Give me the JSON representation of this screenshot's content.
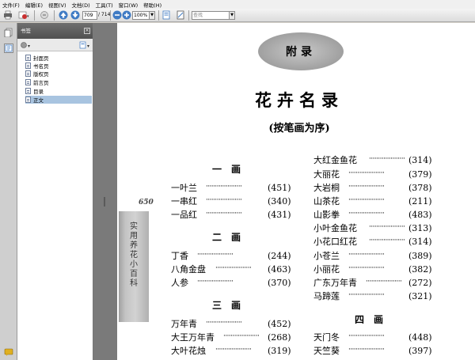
{
  "menu": [
    "文件(F)",
    "编辑(E)",
    "视图(V)",
    "文档(D)",
    "工具(T)",
    "窗口(W)",
    "帮助(H)"
  ],
  "toolbar": {
    "page_current": "709",
    "page_total": "/ 714",
    "zoom": "100%",
    "search_placeholder": "查找"
  },
  "panel": {
    "title": "书签",
    "close": "×",
    "bookmarks": [
      {
        "label": "封面页",
        "selected": false
      },
      {
        "label": "书名页",
        "selected": false
      },
      {
        "label": "版权页",
        "selected": false
      },
      {
        "label": "前言页",
        "selected": false
      },
      {
        "label": "目录",
        "selected": false
      },
      {
        "label": "正文",
        "selected": true
      }
    ]
  },
  "document": {
    "badge": "附录",
    "title": "花卉名录",
    "subtitle": "(按笔画为序)",
    "stamp_number": "650",
    "stamp_text": "实用养花小百科",
    "dots": "····················",
    "left_column": [
      {
        "heading": "一　画",
        "entries": [
          {
            "name": "一叶兰",
            "page": "(451)"
          },
          {
            "name": "一串红",
            "page": "(340)"
          },
          {
            "name": "一品红",
            "page": "(431)"
          }
        ]
      },
      {
        "heading": "二　画",
        "entries": [
          {
            "name": "丁香",
            "page": "(244)"
          },
          {
            "name": "八角金盘",
            "page": "(463)"
          },
          {
            "name": "人参",
            "page": "(370)"
          }
        ]
      },
      {
        "heading": "三　画",
        "entries": [
          {
            "name": "万年青",
            "page": "(452)"
          },
          {
            "name": "大王万年青",
            "page": "(268)"
          },
          {
            "name": "大叶花烛",
            "page": "(319)"
          }
        ]
      }
    ],
    "right_column": [
      {
        "heading": "",
        "entries": [
          {
            "name": "大红金鱼花",
            "page": "(314)"
          },
          {
            "name": "大丽花",
            "page": "(379)"
          },
          {
            "name": "大岩桐",
            "page": "(378)"
          },
          {
            "name": "山茶花",
            "page": "(211)"
          },
          {
            "name": "山影拳",
            "page": "(483)"
          },
          {
            "name": "小叶金鱼花",
            "page": "(313)"
          },
          {
            "name": "小花口红花",
            "page": "(314)"
          },
          {
            "name": "小苍兰",
            "page": "(389)"
          },
          {
            "name": "小丽花",
            "page": "(382)"
          },
          {
            "name": "广东万年青",
            "page": "(272)"
          },
          {
            "name": "马蹄莲",
            "page": "(321)"
          }
        ]
      },
      {
        "heading": "四　画",
        "entries": [
          {
            "name": "天门冬",
            "page": "(448)"
          },
          {
            "name": "天竺葵",
            "page": "(397)"
          }
        ]
      }
    ]
  }
}
